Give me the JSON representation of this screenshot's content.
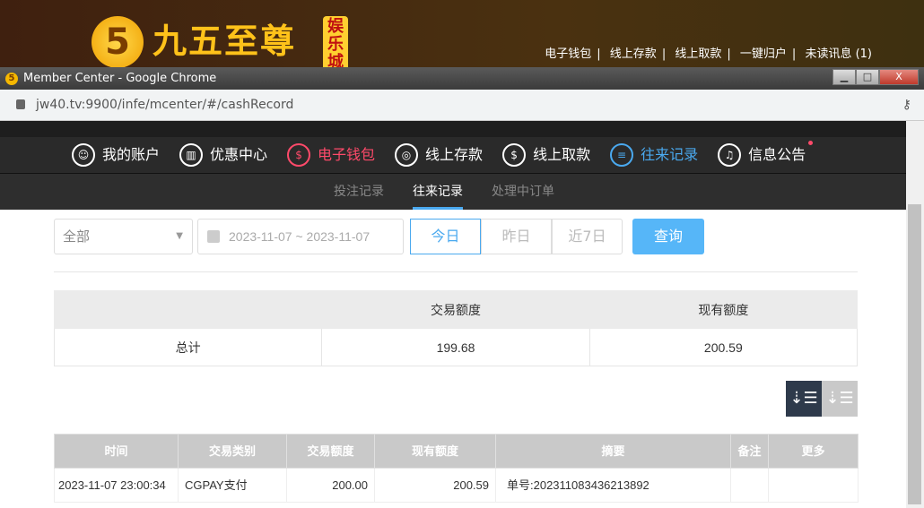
{
  "site": {
    "logo_digit": "5",
    "logo_text": "九五至尊",
    "logo_badge": "娱乐城",
    "top_links": [
      "电子钱包",
      "线上存款",
      "线上取款",
      "一键归户",
      "未读讯息 (1)"
    ]
  },
  "window": {
    "title": "Member Center - Google Chrome",
    "url": "jw40.tv:9900/infe/mcenter/#/cashRecord",
    "min": "▁",
    "max": "□",
    "close": "X"
  },
  "nav": [
    {
      "label": "我的账户",
      "icon": "user-icon"
    },
    {
      "label": "优惠中心",
      "icon": "gift-icon"
    },
    {
      "label": "电子钱包",
      "icon": "wallet-icon"
    },
    {
      "label": "线上存款",
      "icon": "deposit-icon"
    },
    {
      "label": "线上取款",
      "icon": "withdraw-icon"
    },
    {
      "label": "往来记录",
      "icon": "record-icon"
    },
    {
      "label": "信息公告",
      "icon": "bell-icon"
    }
  ],
  "subnav": [
    "投注记录",
    "往来记录",
    "处理中订单"
  ],
  "filters": {
    "type": "全部",
    "date_range": "2023-11-07 ~ 2023-11-07",
    "today": "今日",
    "yesterday": "昨日",
    "last7": "近7日",
    "query": "查询"
  },
  "summary": {
    "headers": [
      "",
      "交易额度",
      "现有额度"
    ],
    "row": [
      "总计",
      "199.68",
      "200.59"
    ]
  },
  "table": {
    "headers": [
      "时间",
      "交易类别",
      "交易额度",
      "现有额度",
      "摘要",
      "备注",
      "更多"
    ],
    "rows": [
      [
        "2023-11-07 23:00:34",
        "CGPAY支付",
        "200.00",
        "200.59",
        "单号:202311083436213892",
        "",
        ""
      ]
    ]
  },
  "colors": {
    "accent": "#4aa9ef",
    "active_red": "#ff4a6a",
    "query_btn": "#56b6f8"
  }
}
